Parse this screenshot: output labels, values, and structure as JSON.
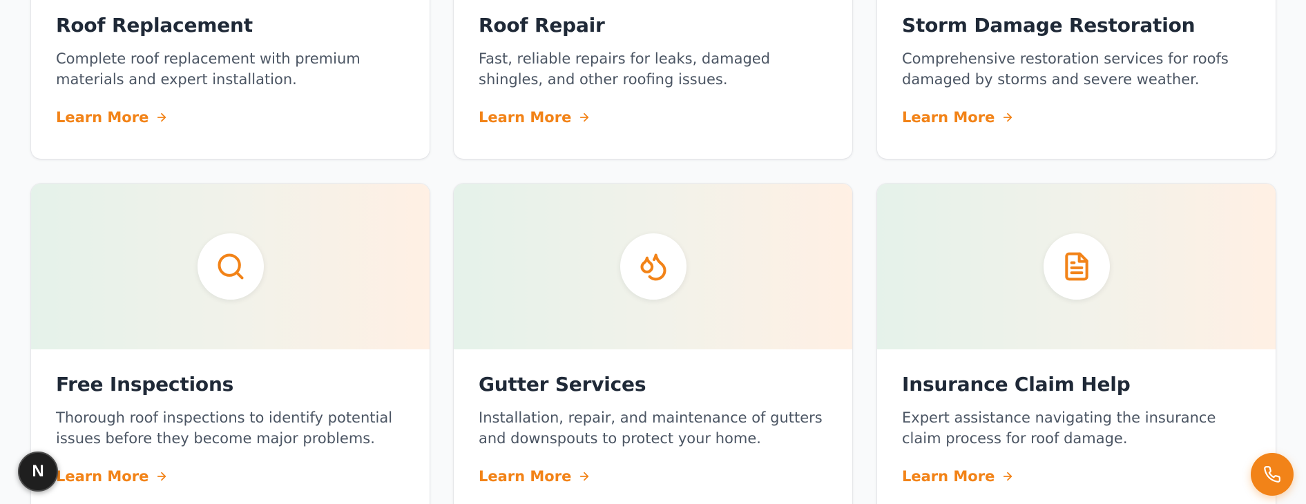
{
  "services": [
    {
      "title": "Roof Replacement",
      "description": "Complete roof replacement with premium materials and expert installation.",
      "link_label": "Learn More"
    },
    {
      "title": "Roof Repair",
      "description": "Fast, reliable repairs for leaks, damaged shingles, and other roofing issues.",
      "link_label": "Learn More"
    },
    {
      "title": "Storm Damage Restoration",
      "description": "Comprehensive restoration services for roofs damaged by storms and severe weather.",
      "link_label": "Learn More"
    },
    {
      "title": "Free Inspections",
      "description": "Thorough roof inspections to identify potential issues before they become major problems.",
      "link_label": "Learn More",
      "icon": "search-icon"
    },
    {
      "title": "Gutter Services",
      "description": "Installation, repair, and maintenance of gutters and downspouts to protect your home.",
      "link_label": "Learn More",
      "icon": "droplets-icon"
    },
    {
      "title": "Insurance Claim Help",
      "description": "Expert assistance navigating the insurance claim process for roof damage.",
      "link_label": "Learn More",
      "icon": "document-icon"
    }
  ],
  "floating": {
    "dev_badge_letter": "N",
    "call_button_icon": "phone-icon"
  },
  "colors": {
    "accent": "#f28318",
    "heading": "#1f2937",
    "body_text": "#4b5563",
    "banner_gradient_start": "#e5f2ea",
    "banner_gradient_end": "#fff0e4"
  }
}
